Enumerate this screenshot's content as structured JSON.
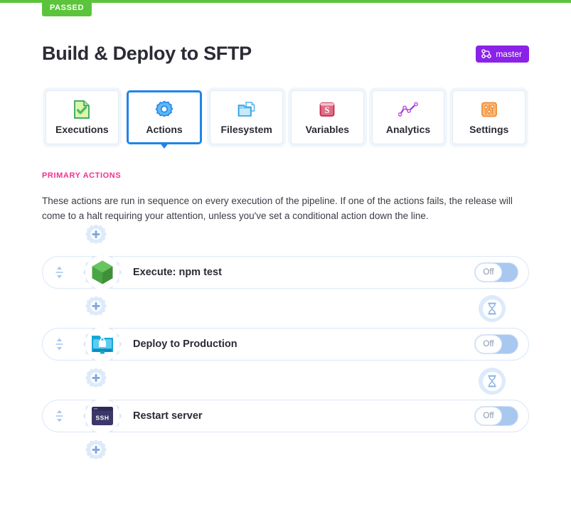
{
  "status": {
    "label": "PASSED",
    "color": "#5cc43c"
  },
  "header": {
    "title": "Build & Deploy to SFTP",
    "branch": {
      "label": "master",
      "icon": "git-branch-icon",
      "color": "#8b22e8"
    }
  },
  "tabs": [
    {
      "label": "Executions",
      "icon": "document-check-icon",
      "active": false
    },
    {
      "label": "Actions",
      "icon": "gear-icon",
      "active": true
    },
    {
      "label": "Filesystem",
      "icon": "folder-icon",
      "active": false
    },
    {
      "label": "Variables",
      "icon": "dollar-icon",
      "active": false
    },
    {
      "label": "Analytics",
      "icon": "line-chart-icon",
      "active": false
    },
    {
      "label": "Settings",
      "icon": "sliders-icon",
      "active": false
    }
  ],
  "section": {
    "title": "PRIMARY ACTIONS",
    "title_color": "#f0338d",
    "description": "These actions are run in sequence on every execution of the pipeline. If one of the actions fails, the release will come to a halt requiring your attention, unless you've set a conditional action down the line."
  },
  "pipeline": {
    "add_icon": "plus-gear-icon",
    "drag_icon": "drag-handle-icon",
    "wait_icon": "hourglass-icon",
    "toggle_label": "Off",
    "actions": [
      {
        "name": "Execute: npm test",
        "icon": "nodejs-icon",
        "toggle": "Off"
      },
      {
        "name": "Deploy to Production",
        "icon": "sftp-folder-lock-icon",
        "toggle": "Off"
      },
      {
        "name": "Restart server",
        "icon": "ssh-terminal-icon",
        "toggle": "Off"
      }
    ]
  }
}
